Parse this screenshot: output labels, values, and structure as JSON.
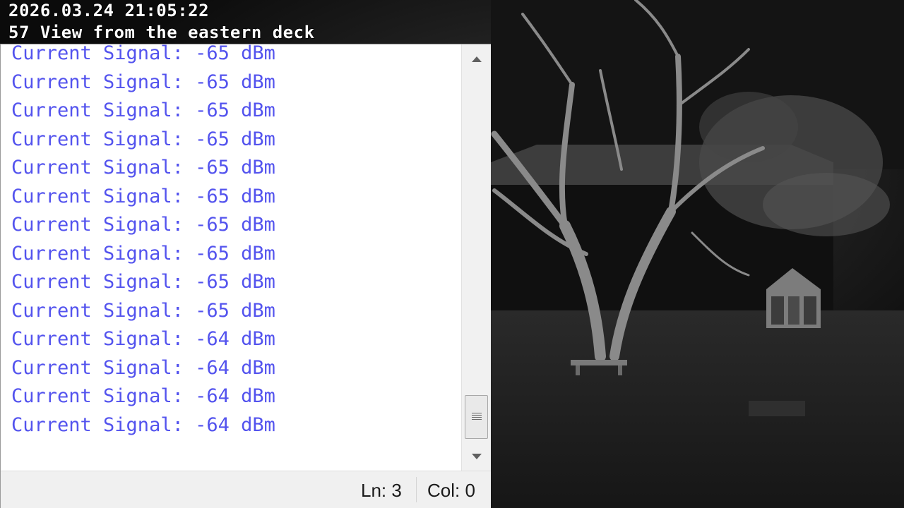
{
  "osd": {
    "timestamp": "2026.03.24 21:05:22",
    "camera_name": "57 View from the eastern deck"
  },
  "viewer": {
    "lines": [
      "Current Signal: -65 dBm",
      "Current Signal: -65 dBm",
      "Current Signal: -65 dBm",
      "Current Signal: -65 dBm",
      "Current Signal: -65 dBm",
      "Current Signal: -65 dBm",
      "Current Signal: -65 dBm",
      "Current Signal: -65 dBm",
      "Current Signal: -65 dBm",
      "Current Signal: -65 dBm",
      "Current Signal: -64 dBm",
      "Current Signal: -64 dBm",
      "Current Signal: -64 dBm",
      "Current Signal: -64 dBm"
    ],
    "text_color": "#5353ee",
    "scroll_position": 0.92,
    "scroll_up_icon": "triangle-up-icon",
    "scroll_down_icon": "triangle-down-icon"
  },
  "status_bar": {
    "line": "Ln: 3",
    "column": "Col: 0"
  }
}
